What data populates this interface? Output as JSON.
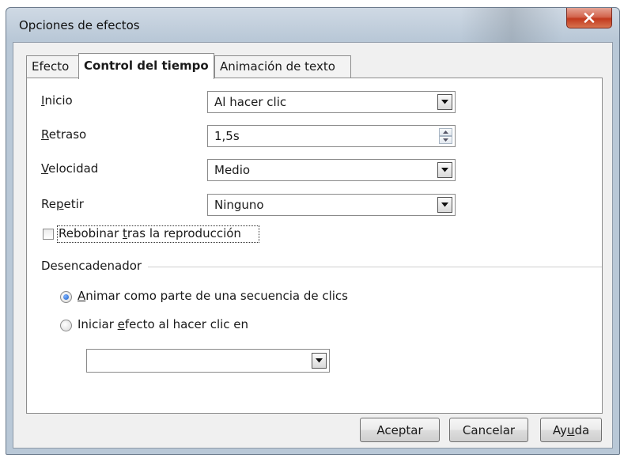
{
  "window": {
    "title": "Opciones de efectos"
  },
  "tabs": [
    {
      "label": "Efecto"
    },
    {
      "label": "Control del tiempo"
    },
    {
      "label": "Animación de texto"
    }
  ],
  "timing": {
    "start": {
      "label_pre": "",
      "label_key": "I",
      "label_post": "nicio",
      "value": "Al hacer clic"
    },
    "delay": {
      "label_pre": "",
      "label_key": "R",
      "label_post": "etraso",
      "value": "1,5s"
    },
    "speed": {
      "label_pre": "",
      "label_key": "V",
      "label_post": "elocidad",
      "value": "Medio"
    },
    "repeat": {
      "label_pre": "Re",
      "label_key": "p",
      "label_post": "etir",
      "value": "Ninguno"
    },
    "rewind": {
      "label_pre": "Rebobinar ",
      "label_key": "t",
      "label_post": "ras la reproducción",
      "checked": false
    }
  },
  "trigger": {
    "heading": "Desencadenador",
    "option_sequence": {
      "label_pre": "",
      "label_key": "A",
      "label_post": "nimar como parte de una secuencia de clics",
      "selected": true
    },
    "option_click": {
      "label_pre": "Iniciar ",
      "label_key": "e",
      "label_post": "fecto al hacer clic en",
      "selected": false
    },
    "shape_value": ""
  },
  "buttons": {
    "ok": "Aceptar",
    "cancel": "Cancelar",
    "help_pre": "Ay",
    "help_key": "u",
    "help_post": "da"
  },
  "icons": {
    "close": "close-x-icon",
    "dropdown": "dropdown-arrow-icon",
    "spin": "spin-up-down-icon"
  },
  "colors": {
    "close_button": "#c94a2e",
    "radio_selected": "#1c5ec6"
  }
}
